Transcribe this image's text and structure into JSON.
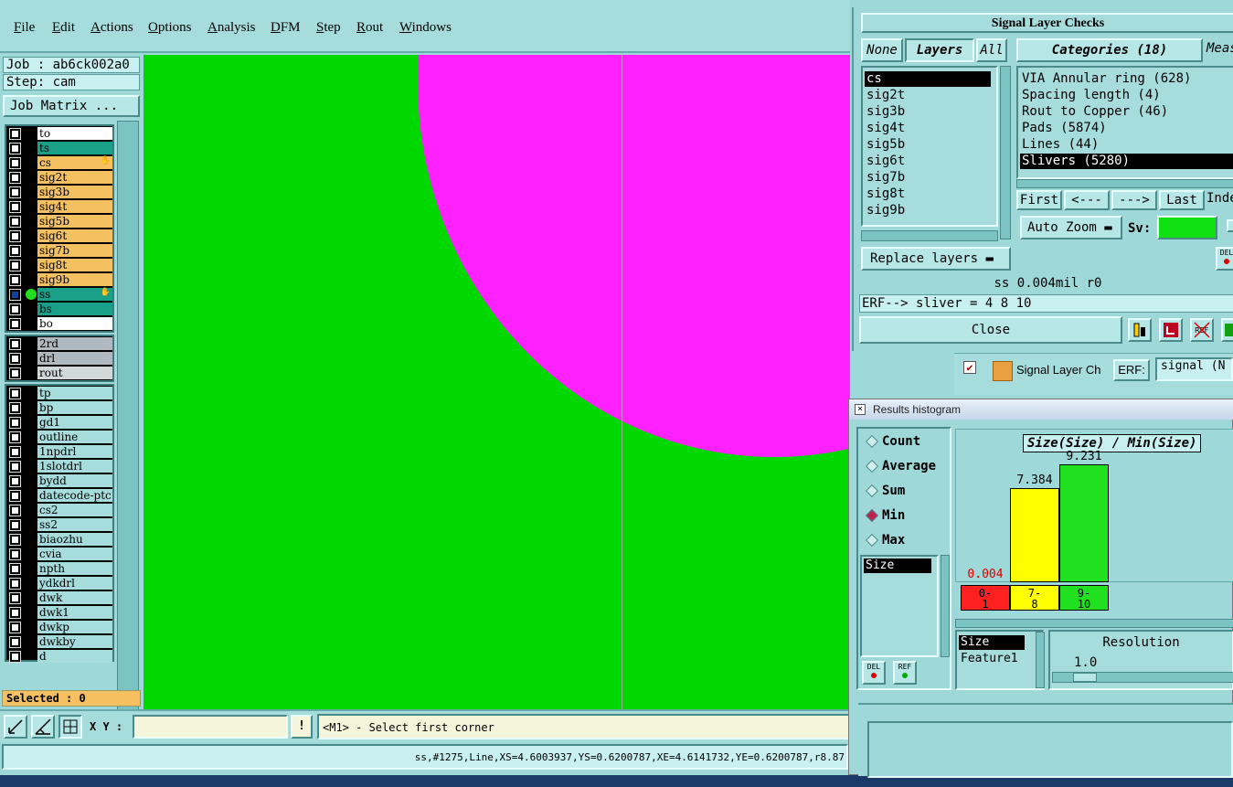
{
  "menu": [
    "File",
    "Edit",
    "Actions",
    "Options",
    "Analysis",
    "DFM",
    "Step",
    "Rout",
    "Windows"
  ],
  "job": {
    "job_line": "Job : ab6ck002a0",
    "step_line": "Step: cam",
    "matrix_button": "Job Matrix ..."
  },
  "layers_group1": [
    "to",
    "ts",
    "cs",
    "sig2t",
    "sig3b",
    "sig4t",
    "sig5b",
    "sig6t",
    "sig7b",
    "sig8t",
    "sig9b",
    "ss",
    "bs",
    "bo"
  ],
  "layers_group2": [
    "2rd",
    "drl",
    "rout"
  ],
  "layers_group3": [
    "tp",
    "bp",
    "gd1",
    "outline",
    "1npdrl",
    "1slotdrl",
    "bydd",
    "datecode-ptc",
    "cs2",
    "ss2",
    "biaozhu",
    "cvia",
    "npth",
    "ydkdrl",
    "dwk",
    "dwk1",
    "dwkp",
    "dwkby",
    "d"
  ],
  "colors": {
    "canvas_bg": "#00d800",
    "pad": "#ff22ff",
    "signal_layer": "#f5c060",
    "mask_layer": "#1aa088",
    "silk_layer": "#ffffff",
    "drill_layer": "#b0b8c0",
    "doc_layer": "#a6dcdc"
  },
  "selected": "Selected : 0",
  "toolbar": {
    "xy_label": "X Y :",
    "xy_value": "",
    "bang": "!",
    "hint": "<M1> - Select first corner"
  },
  "status": "ss,#1275,Line,XS=4.6003937,YS=0.6200787,XE=4.6141732,YE=0.6200787,r8.87",
  "checks": {
    "title": "Signal Layer Checks",
    "tabs": {
      "none": "None",
      "layers": "Layers",
      "all": "All",
      "categories": "Categories (18)",
      "meas": "Meas"
    },
    "layers": [
      "cs",
      "sig2t",
      "sig3b",
      "sig4t",
      "sig5b",
      "sig6t",
      "sig7b",
      "sig8t",
      "sig9b"
    ],
    "categories": [
      "VIA Annular ring (628)",
      "Spacing length (4)",
      "Rout to Copper (46)",
      "Pads (5874)",
      "Lines (44)",
      "Slivers (5280)"
    ],
    "nav": {
      "first": "First",
      "prev": "<---",
      "next": "--->",
      "last": "Last",
      "index": "Index"
    },
    "auto_zoom": "Auto Zoom",
    "sv_label": "Sv:",
    "replace_layers": "Replace layers",
    "size_line": "ss 0.004mil  r0",
    "erf_line": "ERF--> sliver = 4 8 10",
    "close": "Close",
    "del": "DEL",
    "ref": "REF"
  },
  "strip": {
    "label": "Signal Layer Ch",
    "erf": "ERF:",
    "value": "signal (N"
  },
  "hist": {
    "title": "Results histogram",
    "modes": [
      "Count",
      "Average",
      "Sum",
      "Min",
      "Max"
    ],
    "selected_mode": "Min",
    "size_list": [
      "Size"
    ],
    "plot_title": "Size(Size) / Min(Size)",
    "del": "DEL",
    "ref": "REF",
    "size_list2": [
      "Size",
      "Feature1"
    ],
    "resolution_label": "Resolution",
    "resolution_value": "1.0"
  },
  "chart_data": {
    "type": "bar",
    "title": "Size(Size) / Min(Size)",
    "categories": [
      "0-1",
      "7-8",
      "9-10"
    ],
    "values": [
      0.004,
      7.384,
      9.231
    ],
    "colors": [
      "#ff2020",
      "#ffff00",
      "#20e020"
    ],
    "ylim": [
      0,
      10
    ]
  }
}
